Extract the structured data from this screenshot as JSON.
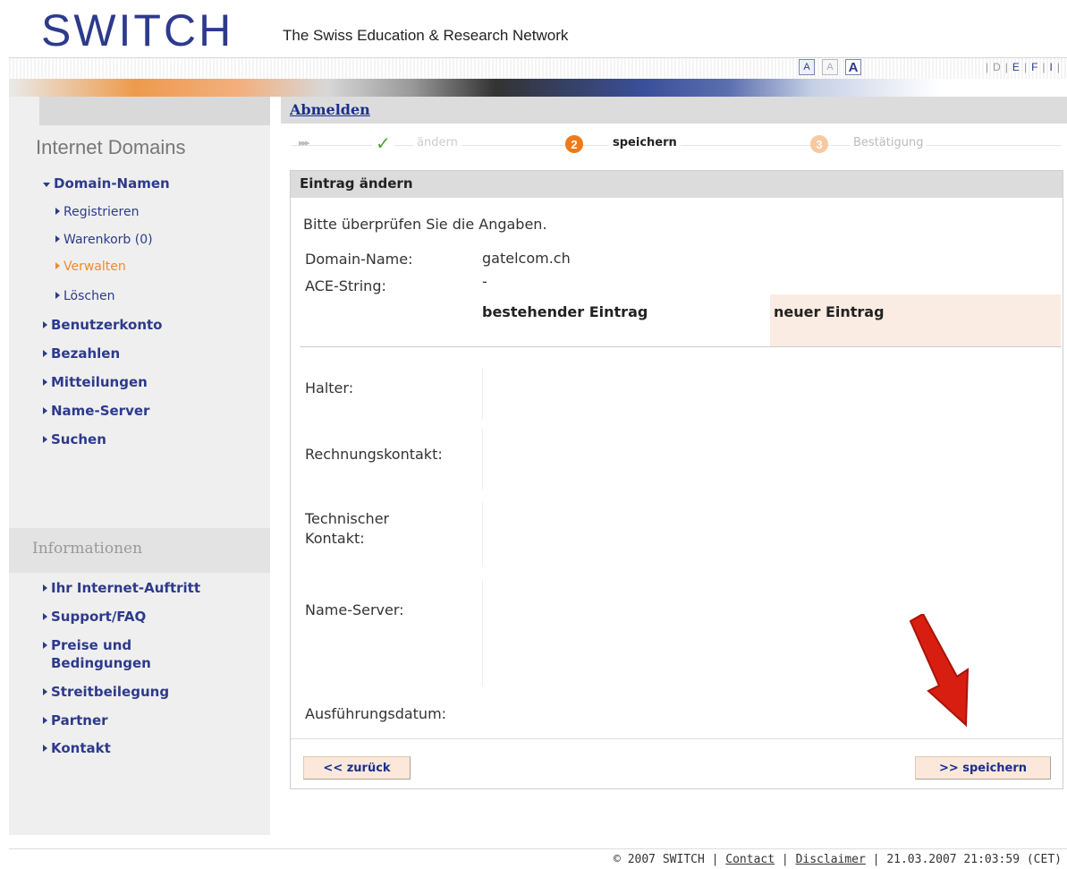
{
  "header": {
    "logo": "SWITCH",
    "tagline": "The Swiss Education & Research Network",
    "font_sizes": [
      "A",
      "A",
      "A"
    ],
    "languages": [
      "D",
      "E",
      "F",
      "I"
    ]
  },
  "sidebar": {
    "title": "Internet Domains",
    "items": [
      {
        "label": "Domain-Namen"
      },
      {
        "label": "Registrieren"
      },
      {
        "label": "Warenkorb (0)"
      },
      {
        "label": "Verwalten"
      },
      {
        "label": "Löschen"
      },
      {
        "label": "Benutzerkonto"
      },
      {
        "label": "Bezahlen"
      },
      {
        "label": "Mitteilungen"
      },
      {
        "label": "Name-Server"
      },
      {
        "label": "Suchen"
      }
    ],
    "info_title": "Informationen",
    "info_items": [
      {
        "label": "Ihr Internet-Auftritt"
      },
      {
        "label": "Support/FAQ"
      },
      {
        "label": "Preise und"
      },
      {
        "label": "Bedingungen"
      },
      {
        "label": "Streitbeilegung"
      },
      {
        "label": "Partner"
      },
      {
        "label": "Kontakt"
      }
    ]
  },
  "main": {
    "logout": "Abmelden",
    "steps": {
      "done": "ändern",
      "current_number": "2",
      "current": "speichern",
      "future_number": "3",
      "future": "Bestätigung"
    },
    "panel_title": "Eintrag ändern",
    "intro": "Bitte überprüfen Sie die Angaben.",
    "domain_label": "Domain-Name:",
    "domain_value": "gatelcom.ch",
    "ace_label": "ACE-String:",
    "ace_value": "-",
    "col_existing": "bestehender Eintrag",
    "col_new": "neuer Eintrag",
    "rows": {
      "halter": "Halter:",
      "rechnung": "Rechnungskontakt:",
      "tech1": "Technischer",
      "tech2": "Kontakt:",
      "ns": "Name-Server:",
      "datum": "Ausführungsdatum:"
    },
    "back_button": "<< zurück",
    "save_button": ">> speichern"
  },
  "footer": {
    "copyright": "© 2007 SWITCH |",
    "contact": "Contact",
    "sep": "|",
    "disclaimer": "Disclaimer",
    "timestamp": "| 21.03.2007 21:03:59 (CET)"
  },
  "colors": {
    "brand_blue": "#2d3a8c",
    "accent_orange": "#ef7a1a",
    "highlight_peach": "#fbece3",
    "arrow_red": "#d81e10"
  }
}
